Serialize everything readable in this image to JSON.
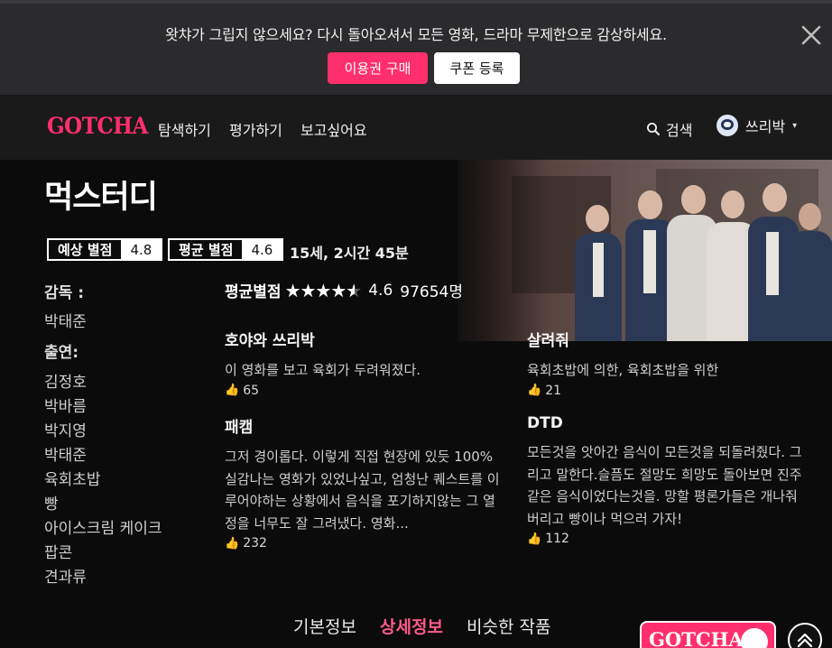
{
  "banner": {
    "message": "왓챠가 그립지 않으세요? 다시 돌아오셔서 모든 영화, 드라마 무제한으로 감상하세요.",
    "buy_label": "이용권 구매",
    "coupon_label": "쿠폰 등록",
    "close_icon": "close-icon"
  },
  "nav": {
    "logo": "GOTCHA",
    "links": [
      "탐색하기",
      "평가하기",
      "보고싶어요"
    ],
    "search_label": "검색",
    "user_name": "쓰리박",
    "user_caret": "▾"
  },
  "movie": {
    "title": "먹스터디",
    "expected_label": "예상 별점",
    "expected_value": "4.8",
    "average_label": "평균 별점",
    "average_value": "4.6",
    "age_runtime": "15세, 2시간 45분"
  },
  "credits": {
    "director_heading": "감독 :",
    "director": "박태준",
    "cast_heading": "출연:",
    "cast": [
      "김정호",
      "박바름",
      "박지영",
      "박태준",
      "육회초밥",
      "빵",
      "아이스크림 케이크",
      "팝콘",
      "견과류"
    ]
  },
  "rating": {
    "label": "평균별점",
    "stars_glyph": "★★★★★",
    "stars_fraction": 0.92,
    "score": "4.6",
    "count": "97654명"
  },
  "reviews": [
    {
      "name": "호야와 쓰리박",
      "text": "이 영화를 보고 육회가 두려워졌다.",
      "likes": "65"
    },
    {
      "name": "살려줘",
      "text": "육회초밥에 의한, 육회초밥을 위한",
      "likes": "21"
    },
    {
      "name": "패캠",
      "text": "그저 경이롭다. 이렇게 직접 현장에 있듯 100% 실감나는 영화가 있었나싶고, 엄청난 퀘스트를 이루어야하는 상황에서 음식을 포기하지않는 그 열정을 너무도 잘 그려냈다. 영화...",
      "likes": "232"
    },
    {
      "name": "DTD",
      "text": "모든것을 앗아간 음식이 모든것을 되돌려줬다. 그리고 말한다.슬픔도 절망도 희망도 돌아보면 진주같은 음식이었다는것을. 망할 평론가들은 개나줘버리고 빵이나 먹으러 가자!",
      "likes": "112"
    }
  ],
  "like_icon": "thumbs-up-icon",
  "tabs": [
    "기본정보",
    "상세정보",
    "비슷한 작품"
  ],
  "float_badge": "GOTCHA!",
  "colors": {
    "accent": "#ff2f6e",
    "background": "#0b0b0b",
    "nav": "#1a1a1b",
    "banner": "#2b2b2d"
  }
}
